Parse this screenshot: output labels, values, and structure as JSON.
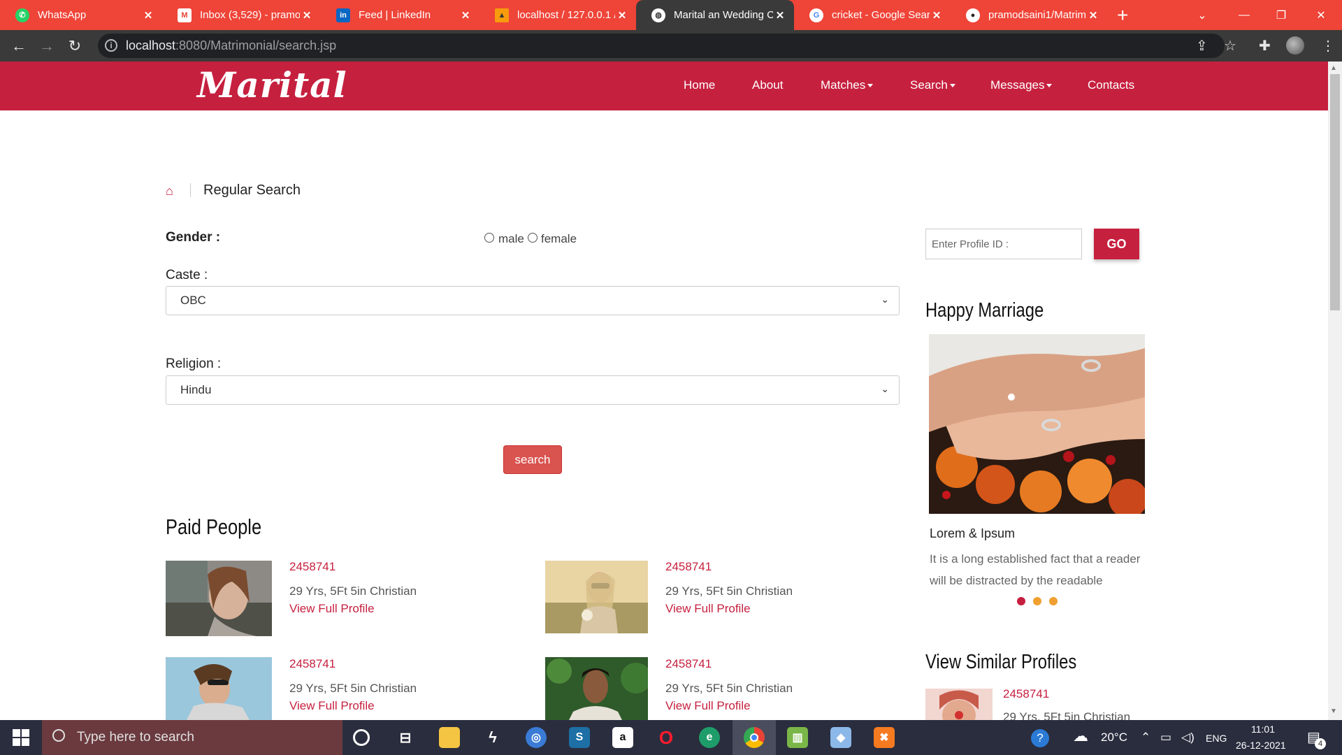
{
  "browser": {
    "tabs": [
      {
        "label": "WhatsApp",
        "icon": "whatsapp-icon",
        "color": "#25d366"
      },
      {
        "label": "Inbox (3,529) - pramo",
        "icon": "gmail-icon",
        "color": "#ffffff"
      },
      {
        "label": "Feed | LinkedIn",
        "icon": "linkedin-icon",
        "color": "#0a66c2"
      },
      {
        "label": "localhost / 127.0.0.1 /",
        "icon": "phpmyadmin-icon",
        "color": "#f89c0e"
      },
      {
        "label": "Marital an Wedding C",
        "icon": "globe-icon",
        "color": "#ffffff"
      },
      {
        "label": "cricket - Google Sear",
        "icon": "google-icon",
        "color": "#ffffff"
      },
      {
        "label": "pramodsaini1/Matrim",
        "icon": "github-icon",
        "color": "#ffffff"
      }
    ],
    "url_host": "localhost",
    "url_path": ":8080/Matrimonial/search.jsp"
  },
  "site": {
    "logo": "Marital",
    "nav": [
      {
        "label": "Home",
        "dropdown": false
      },
      {
        "label": "About",
        "dropdown": false
      },
      {
        "label": "Matches",
        "dropdown": true
      },
      {
        "label": "Search",
        "dropdown": true
      },
      {
        "label": "Messages",
        "dropdown": true
      },
      {
        "label": "Contacts",
        "dropdown": false
      }
    ],
    "brand_color": "#c6203f"
  },
  "page": {
    "breadcrumb": "Regular Search",
    "gender_label": "Gender :",
    "gender_options": [
      "male",
      "female"
    ],
    "caste_label": "Caste :",
    "caste_value": "OBC",
    "religion_label": "Religion :",
    "religion_value": "Hindu",
    "search_button": "search",
    "paid_title": "Paid People",
    "profiles": [
      {
        "id": "2458741",
        "desc": "29 Yrs, 5Ft 5in Christian",
        "link": "View Full Profile"
      },
      {
        "id": "2458741",
        "desc": "29 Yrs, 5Ft 5in Christian",
        "link": "View Full Profile"
      },
      {
        "id": "2458741",
        "desc": "29 Yrs, 5Ft 5in Christian",
        "link": "View Full Profile"
      },
      {
        "id": "2458741",
        "desc": "29 Yrs, 5Ft 5in Christian",
        "link": "View Full Profile"
      }
    ]
  },
  "sidebar": {
    "profile_id_placeholder": "Enter Profile ID :",
    "go_button": "GO",
    "happy_title": "Happy Marriage",
    "caption_title": "Lorem & Ipsum",
    "caption_text": "It is a long established fact that a reader will be distracted by the readable",
    "similar_title": "View Similar Profiles",
    "similar_id": "2458741",
    "similar_desc": "29 Yrs, 5Ft 5in Christian"
  },
  "taskbar": {
    "search_placeholder": "Type here to search",
    "temperature": "20°C",
    "language": "ENG",
    "time": "11:01",
    "date": "26-12-2021",
    "notification_count": "4"
  }
}
